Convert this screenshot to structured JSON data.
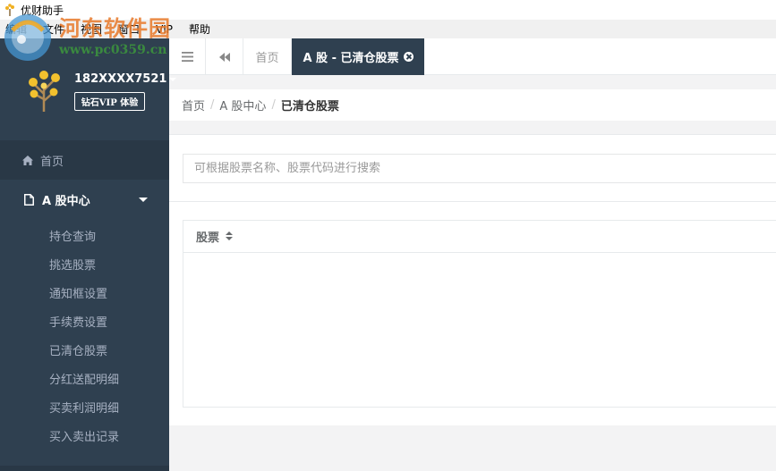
{
  "window": {
    "title": "优财助手"
  },
  "menubar": {
    "items": [
      "编辑",
      "文件",
      "视图",
      "窗口",
      "VIP",
      "帮助"
    ]
  },
  "watermark": {
    "title": "河东软件园",
    "url": "www.pc0359.cn"
  },
  "sidebar": {
    "user": {
      "username": "182XXXX7521",
      "vip_label": "钻石VIP 体验"
    },
    "home_label": "首页",
    "group_label": "A 股中心",
    "sub_items": [
      "持仓查询",
      "挑选股票",
      "通知框设置",
      "手续费设置",
      "已清仓股票",
      "分红送配明细",
      "买卖利润明细",
      "买入卖出记录"
    ]
  },
  "topbar": {
    "home_tab": "首页",
    "active_tab": "A 股 - 已清仓股票"
  },
  "breadcrumb": {
    "items": [
      "首页",
      "A 股中心"
    ],
    "current": "已清仓股票"
  },
  "search": {
    "placeholder": "可根据股票名称、股票代码进行搜索",
    "value": ""
  },
  "table": {
    "columns": [
      "股票"
    ],
    "rows": []
  },
  "colors": {
    "sidebar_bg": "#2f4050",
    "active_tab_bg": "#2f4050",
    "page_bg": "#f3f3f4"
  }
}
